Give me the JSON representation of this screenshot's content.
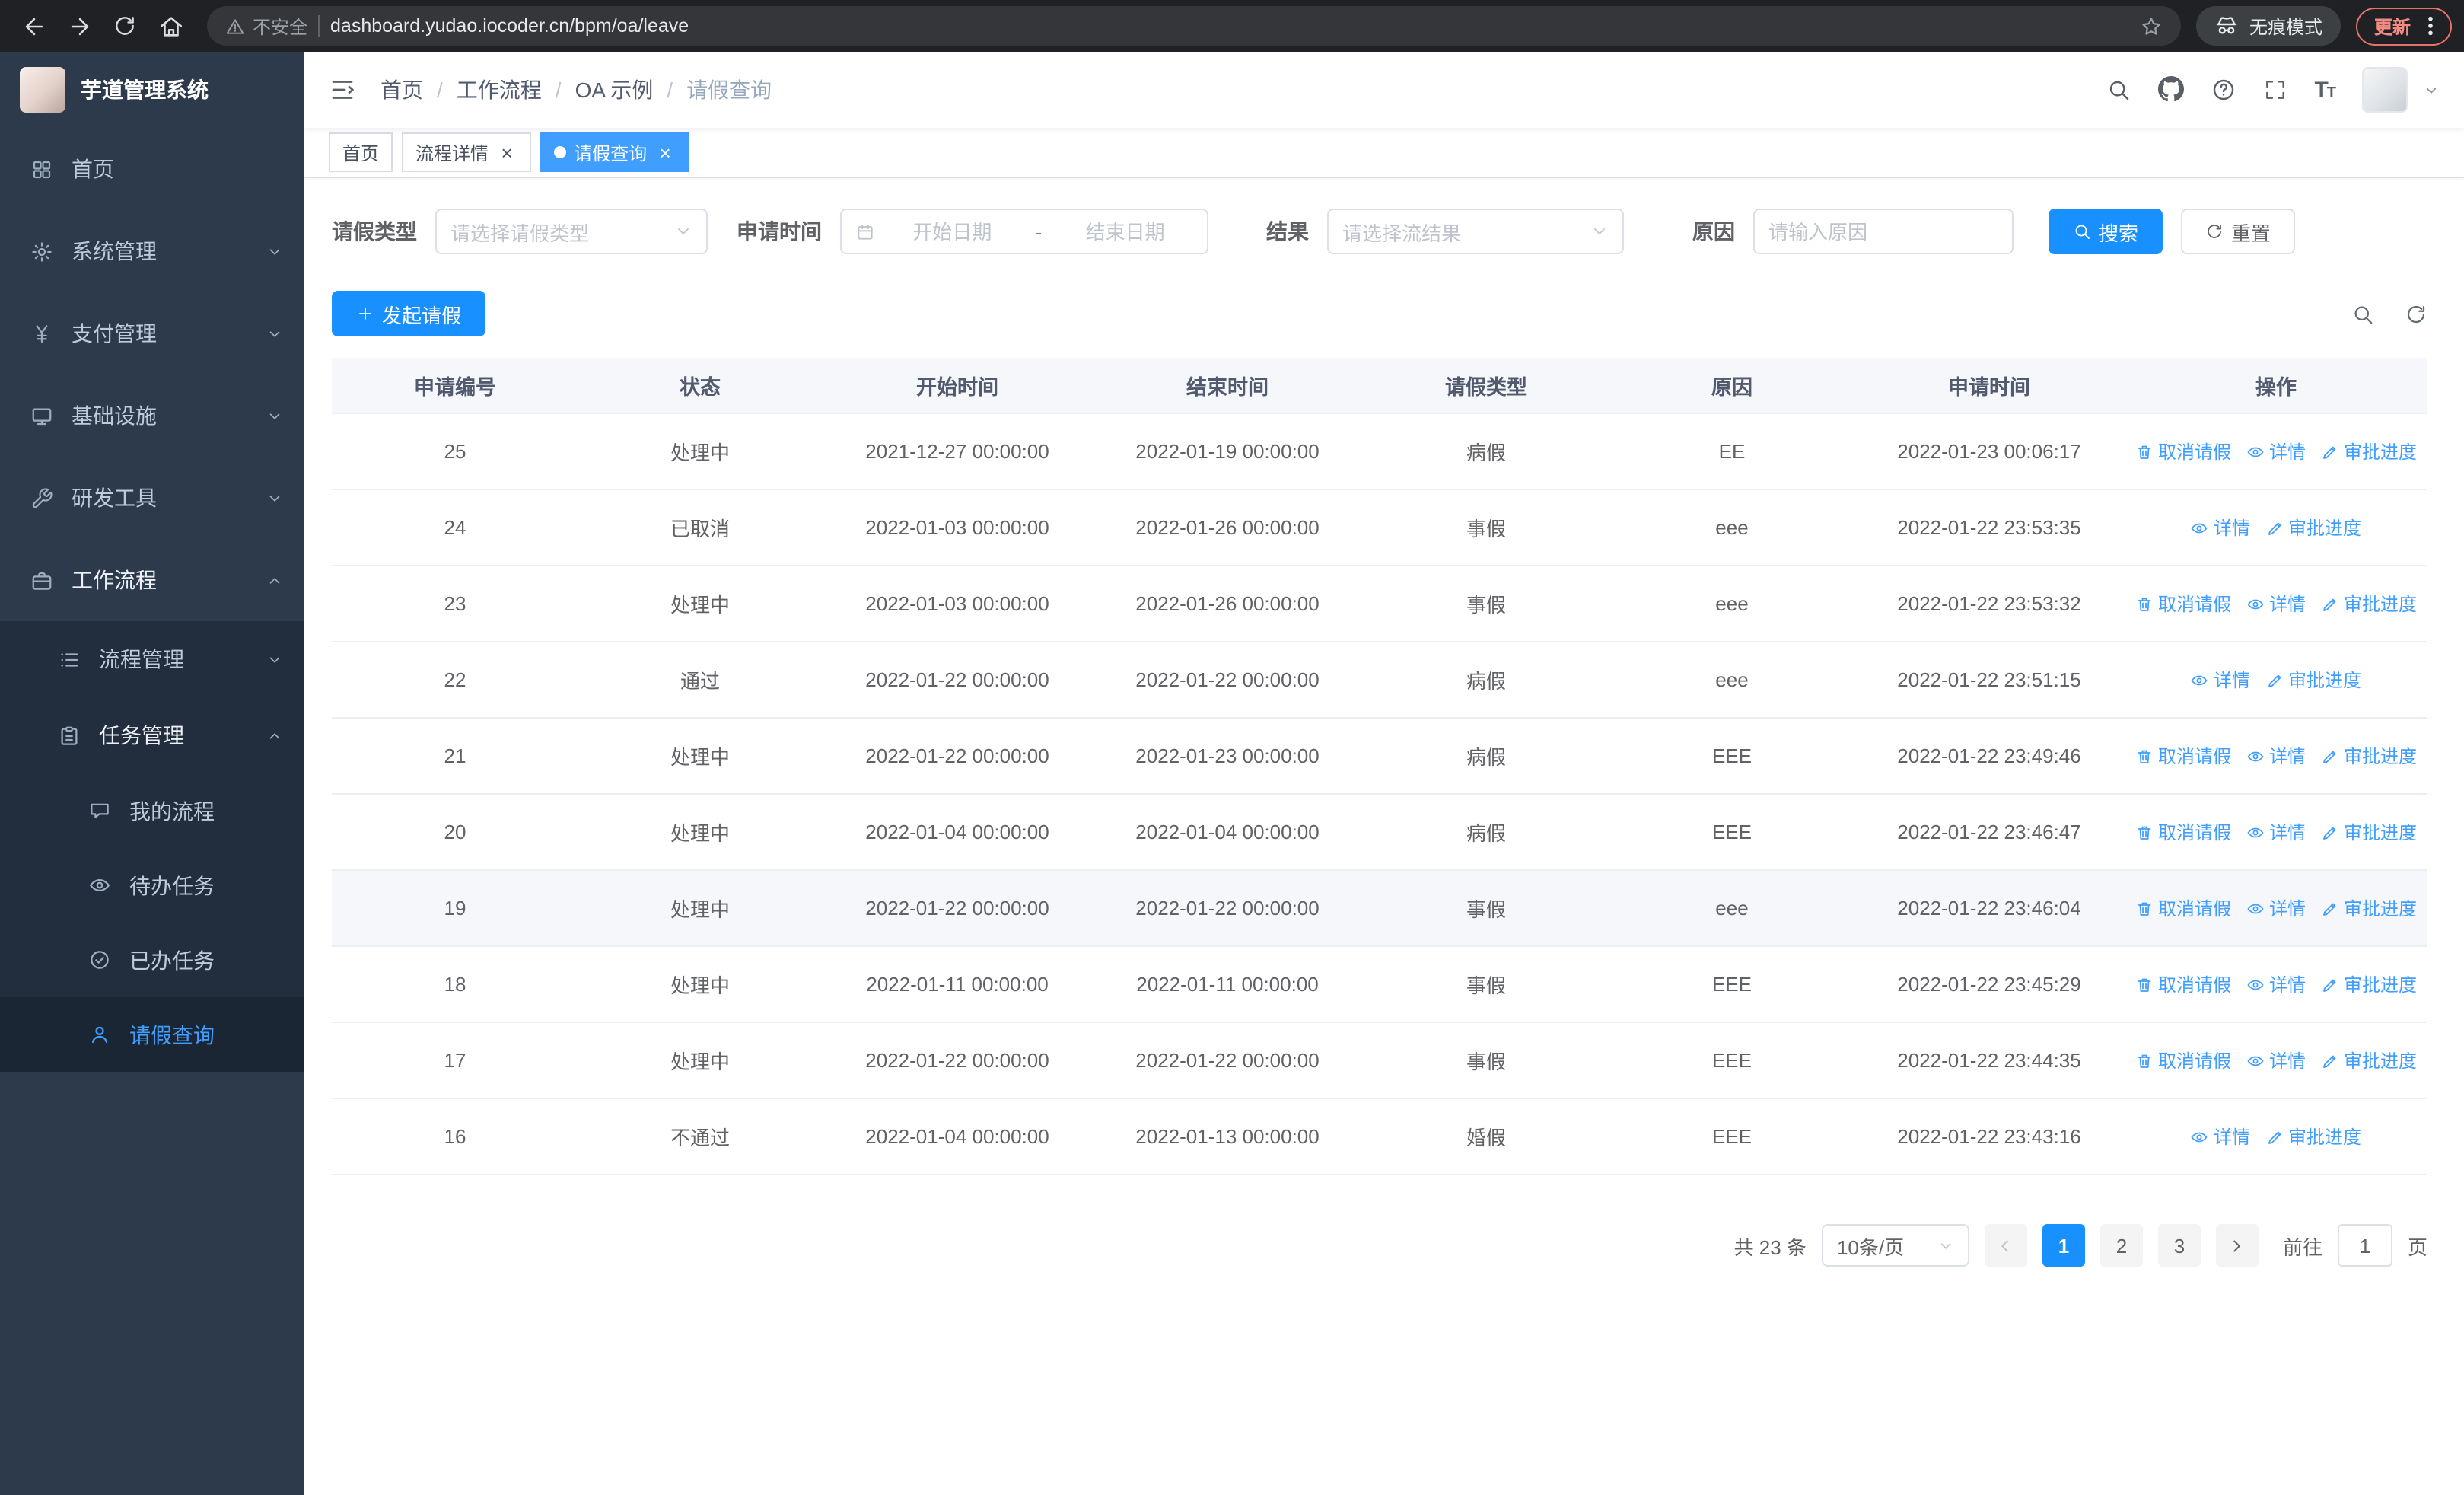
{
  "browser": {
    "security_label": "不安全",
    "url": "dashboard.yudao.iocoder.cn/bpm/oa/leave",
    "incognito_label": "无痕模式",
    "update_label": "更新"
  },
  "sidebar": {
    "app_title": "芋道管理系统",
    "items": {
      "home": "首页",
      "system": "系统管理",
      "payment": "支付管理",
      "infra": "基础设施",
      "devtools": "研发工具",
      "workflow": "工作流程",
      "process_mgmt": "流程管理",
      "task_mgmt": "任务管理",
      "my_process": "我的流程",
      "todo_tasks": "待办任务",
      "done_tasks": "已办任务",
      "leave_query": "请假查询"
    }
  },
  "breadcrumb": {
    "items": [
      "首页",
      "工作流程",
      "OA 示例",
      "请假查询"
    ],
    "separator": "/"
  },
  "tabs": {
    "home": "首页",
    "process_detail": "流程详情",
    "leave_query": "请假查询"
  },
  "filters": {
    "leave_type_label": "请假类型",
    "leave_type_placeholder": "请选择请假类型",
    "apply_time_label": "申请时间",
    "start_placeholder": "开始日期",
    "range_separator": "-",
    "end_placeholder": "结束日期",
    "result_label": "结果",
    "result_placeholder": "请选择流结果",
    "reason_label": "原因",
    "reason_placeholder": "请输入原因",
    "search_button": "搜索",
    "reset_button": "重置"
  },
  "toolbar": {
    "create_button": "发起请假"
  },
  "table": {
    "columns": [
      "申请编号",
      "状态",
      "开始时间",
      "结束时间",
      "请假类型",
      "原因",
      "申请时间",
      "操作"
    ],
    "ops": {
      "cancel": "取消请假",
      "detail": "详情",
      "progress": "审批进度"
    },
    "rows": [
      {
        "id": "25",
        "status": "处理中",
        "start": "2021-12-27 00:00:00",
        "end": "2022-01-19 00:00:00",
        "type": "病假",
        "reason": "EE",
        "apply_time": "2022-01-23 00:06:17"
      },
      {
        "id": "24",
        "status": "已取消",
        "start": "2022-01-03 00:00:00",
        "end": "2022-01-26 00:00:00",
        "type": "事假",
        "reason": "eee",
        "apply_time": "2022-01-22 23:53:35"
      },
      {
        "id": "23",
        "status": "处理中",
        "start": "2022-01-03 00:00:00",
        "end": "2022-01-26 00:00:00",
        "type": "事假",
        "reason": "eee",
        "apply_time": "2022-01-22 23:53:32"
      },
      {
        "id": "22",
        "status": "通过",
        "start": "2022-01-22 00:00:00",
        "end": "2022-01-22 00:00:00",
        "type": "病假",
        "reason": "eee",
        "apply_time": "2022-01-22 23:51:15"
      },
      {
        "id": "21",
        "status": "处理中",
        "start": "2022-01-22 00:00:00",
        "end": "2022-01-23 00:00:00",
        "type": "病假",
        "reason": "EEE",
        "apply_time": "2022-01-22 23:49:46"
      },
      {
        "id": "20",
        "status": "处理中",
        "start": "2022-01-04 00:00:00",
        "end": "2022-01-04 00:00:00",
        "type": "病假",
        "reason": "EEE",
        "apply_time": "2022-01-22 23:46:47"
      },
      {
        "id": "19",
        "status": "处理中",
        "start": "2022-01-22 00:00:00",
        "end": "2022-01-22 00:00:00",
        "type": "事假",
        "reason": "eee",
        "apply_time": "2022-01-22 23:46:04"
      },
      {
        "id": "18",
        "status": "处理中",
        "start": "2022-01-11 00:00:00",
        "end": "2022-01-11 00:00:00",
        "type": "事假",
        "reason": "EEE",
        "apply_time": "2022-01-22 23:45:29"
      },
      {
        "id": "17",
        "status": "处理中",
        "start": "2022-01-22 00:00:00",
        "end": "2022-01-22 00:00:00",
        "type": "事假",
        "reason": "EEE",
        "apply_time": "2022-01-22 23:44:35"
      },
      {
        "id": "16",
        "status": "不通过",
        "start": "2022-01-04 00:00:00",
        "end": "2022-01-13 00:00:00",
        "type": "婚假",
        "reason": "EEE",
        "apply_time": "2022-01-22 23:43:16"
      }
    ]
  },
  "pagination": {
    "total": "共 23 条",
    "page_size": "10条/页",
    "pages": [
      "1",
      "2",
      "3"
    ],
    "goto_label": "前往",
    "goto_value": "1",
    "page_unit": "页"
  },
  "colors": {
    "primary": "#1890ff",
    "link": "#409eff",
    "active_tab": "#409eff",
    "sidebar_bg": "#2d3a4b",
    "sidebar_sub_bg": "#222d3d",
    "sidebar_text": "#bfcbd9"
  }
}
